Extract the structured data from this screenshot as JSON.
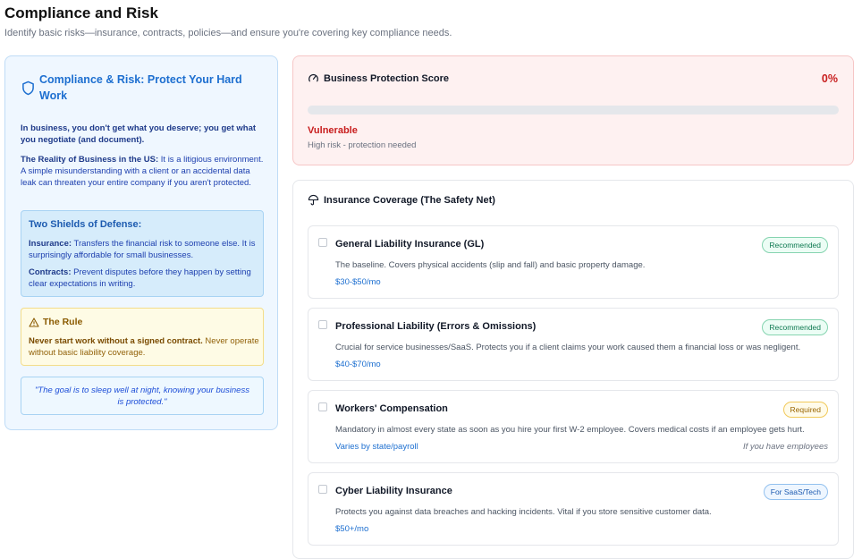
{
  "page": {
    "title": "Compliance and Risk",
    "subtitle": "Identify basic risks—insurance, contracts, policies—and ensure you're covering key compliance needs."
  },
  "info": {
    "title": "Compliance & Risk: Protect Your Hard Work",
    "quote": "In business, you don't get what you deserve; you get what you negotiate (and document).",
    "reality_label": "The Reality of Business in the US:",
    "reality_text": " It is a litigious environment. A simple misunderstanding with a client or an accidental data leak can threaten your entire company if you aren't protected.",
    "shields": {
      "title": "Two Shields of Defense:",
      "insurance_label": "Insurance:",
      "insurance_text": " Transfers the financial risk to someone else. It is surprisingly affordable for small businesses.",
      "contracts_label": "Contracts:",
      "contracts_text": " Prevent disputes before they happen by setting clear expectations in writing."
    },
    "rule": {
      "title": "The Rule",
      "bold": "Never start work without a signed contract.",
      "text": " Never operate without basic liability coverage."
    },
    "goal": "\"The goal is to sleep well at night, knowing your business is protected.\""
  },
  "score": {
    "title": "Business Protection Score",
    "value": "0%",
    "progress": 0,
    "status": "Vulnerable",
    "description": "High risk - protection needed",
    "color": "#dc2626"
  },
  "insurance": {
    "title": "Insurance Coverage (The Safety Net)",
    "items": [
      {
        "name": "General Liability Insurance (GL)",
        "badge": "Recommended",
        "description": "The baseline. Covers physical accidents (slip and fall) and basic property damage.",
        "price": "$30-$50/mo",
        "note": "",
        "checked": false
      },
      {
        "name": "Professional Liability (Errors & Omissions)",
        "badge": "Recommended",
        "description": "Crucial for service businesses/SaaS. Protects you if a client claims your work caused them a financial loss or was negligent.",
        "price": "$40-$70/mo",
        "note": "",
        "checked": false
      },
      {
        "name": "Workers' Compensation",
        "badge": "Required",
        "description": "Mandatory in almost every state as soon as you hire your first W-2 employee. Covers medical costs if an employee gets hurt.",
        "price": "Varies by state/payroll",
        "note": "If you have employees",
        "checked": false
      },
      {
        "name": "Cyber Liability Insurance",
        "badge": "For SaaS/Tech",
        "description": "Protects you against data breaches and hacking incidents. Vital if you store sensitive customer data.",
        "price": "$50+/mo",
        "note": "",
        "checked": false
      }
    ]
  }
}
